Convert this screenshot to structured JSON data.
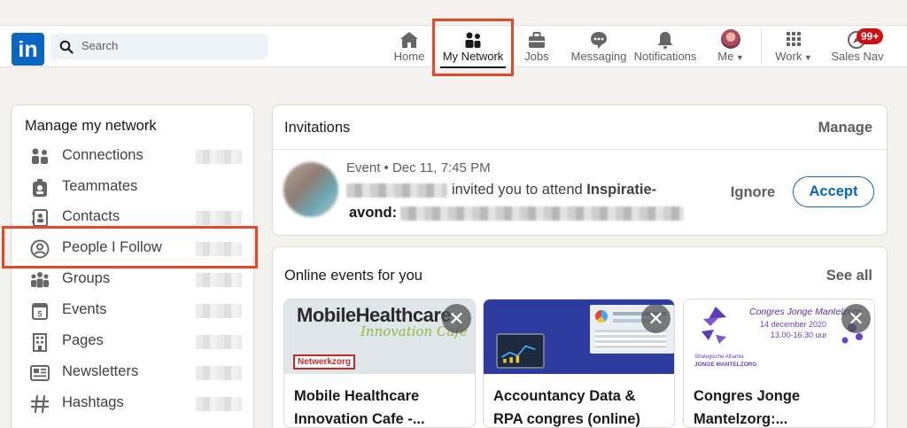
{
  "header": {
    "search_placeholder": "Search",
    "nav": [
      {
        "label": "Home",
        "icon": "home-icon"
      },
      {
        "label": "My Network",
        "icon": "people-icon",
        "active": true
      },
      {
        "label": "Jobs",
        "icon": "briefcase-icon"
      },
      {
        "label": "Messaging",
        "icon": "chat-icon"
      },
      {
        "label": "Notifications",
        "icon": "bell-icon"
      },
      {
        "label": "Me",
        "icon": "avatar"
      },
      {
        "label": "Work",
        "icon": "grid-icon"
      },
      {
        "label": "Sales Nav",
        "icon": "compass-icon"
      }
    ],
    "sales_nav_badge": "99+",
    "logo_text": "in"
  },
  "sidebar": {
    "title": "Manage my network",
    "items": [
      {
        "label": "Connections",
        "icon": "connections-icon"
      },
      {
        "label": "Teammates",
        "icon": "teammates-icon"
      },
      {
        "label": "Contacts",
        "icon": "contacts-icon"
      },
      {
        "label": "People I Follow",
        "icon": "follow-icon"
      },
      {
        "label": "Groups",
        "icon": "groups-icon"
      },
      {
        "label": "Events",
        "icon": "calendar-icon"
      },
      {
        "label": "Pages",
        "icon": "building-icon"
      },
      {
        "label": "Newsletters",
        "icon": "newsletter-icon"
      },
      {
        "label": "Hashtags",
        "icon": "hashtag-icon"
      }
    ]
  },
  "invitations": {
    "title": "Invitations",
    "manage_label": "Manage",
    "meta_prefix": "Event",
    "meta_date": "Dec 11, 7:45 PM",
    "invite_text": "invited you to attend",
    "event_name_part1": "Inspiratie-",
    "event_name_part2": "avond:",
    "ignore_label": "Ignore",
    "accept_label": "Accept"
  },
  "events": {
    "title": "Online events for you",
    "see_all_label": "See all",
    "cards": [
      {
        "title_line1": "Mobile Healthcare",
        "title_line2": "Innovation Cafe -...",
        "banner_text": "MobileHealthcare",
        "banner_sub": "Innovation Cafe",
        "banner_tag": "Netwerkzorg"
      },
      {
        "title_line1": "Accountancy Data &",
        "title_line2": "RPA congres (online)"
      },
      {
        "title_line1": "Congres Jonge",
        "title_line2": "Mantelzorg:...",
        "banner_text": "Congres Jonge Mantelzorg",
        "banner_date": "14 december 2020",
        "banner_time": "13.00-16.30 uur",
        "banner_org1": "Strategische Alliantie",
        "banner_org2": "JONGE MANTELZORG"
      }
    ]
  },
  "colors": {
    "brand": "#0a66c2",
    "highlight_box": "#e8472a",
    "badge": "#cc1016"
  }
}
